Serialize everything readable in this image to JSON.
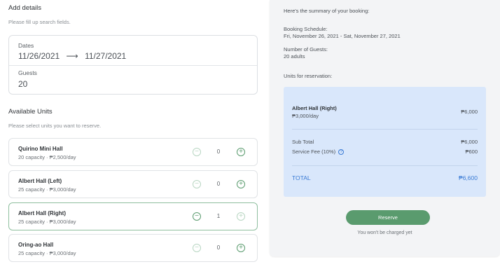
{
  "details": {
    "title": "Add details",
    "subtitle": "Please fill up search fields.",
    "dates_label": "Dates",
    "check_in": "11/26/2021",
    "arrow": "⟶",
    "check_out": "11/27/2021",
    "guests_label": "Guests",
    "guests_value": "20"
  },
  "units": {
    "title": "Available Units",
    "subtitle": "Please select units you want to reserve.",
    "items": [
      {
        "name": "Quirino Mini Hall",
        "meta": "20 capacity · ₱2,500/day",
        "qty": "0",
        "selected": false
      },
      {
        "name": "Albert Hall (Left)",
        "meta": "25 capacity · ₱3,000/day",
        "qty": "0",
        "selected": false
      },
      {
        "name": "Albert Hall (Right)",
        "meta": "25 capacity · ₱3,000/day",
        "qty": "1",
        "selected": true
      },
      {
        "name": "Oring-ao Hall",
        "meta": "25 capacity · ₱3,000/day",
        "qty": "0",
        "selected": false
      }
    ]
  },
  "summary": {
    "intro": "Here's the summary of your booking:",
    "schedule_label": "Booking Schedule:",
    "schedule_value": "Fri, November 26, 2021 - Sat, November 27, 2021",
    "guests_label": "Number of Guests:",
    "guests_value": "20 adults",
    "units_label": "Units for reservation:",
    "reserved_unit_name": "Albert Hall (Right)",
    "reserved_unit_rate": "₱3,000/day",
    "reserved_unit_price": "₱6,000",
    "subtotal_label": "Sub Total",
    "subtotal_value": "₱6,000",
    "fee_label": "Service Fee (10%)",
    "fee_icon": "?",
    "fee_value": "₱600",
    "total_label": "TOTAL",
    "total_value": "₱6,600",
    "reserve_label": "Reserve",
    "charge_note": "You won't be charged yet"
  },
  "colors": {
    "accent_green": "#5a9b6e",
    "panel_blue": "#d9e7fb",
    "total_blue": "#3a7bd5"
  }
}
